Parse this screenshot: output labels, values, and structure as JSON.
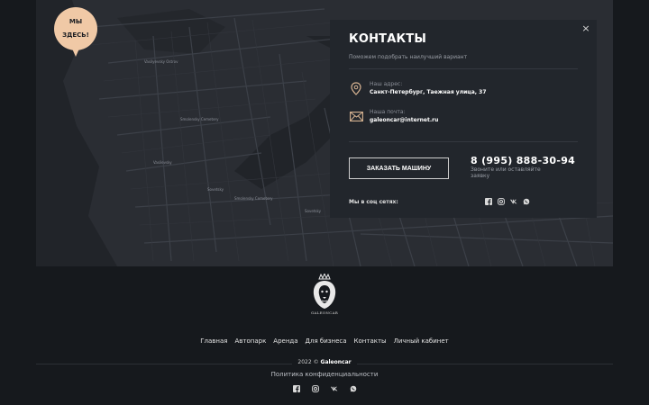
{
  "map": {
    "pin": {
      "line1": "МЫ",
      "line2": "ЗДЕСЬ!"
    },
    "labels": [
      "Smolensky Cemetery",
      "Vasilevsky",
      "Sovetsky",
      "Smolensky Cemetery",
      "Sovetsky",
      "Vasilyevsky Ostrov"
    ]
  },
  "contacts": {
    "close_label": "×",
    "title": "КОНТАКТЫ",
    "subtitle": "Поможем подобрать наилучший вариант",
    "address_label": "Наш адрес:",
    "address_value": "Санкт-Петербург, Таежная улица, 37",
    "email_label": "Наша почта:",
    "email_value": "galeoncar@internet.ru",
    "cta_label": "ЗАКАЗАТЬ МАШИНУ",
    "phone": "8 (995) 888-30-94",
    "phone_note": "Звоните или оставляйте заявку",
    "social_label": "Мы в соц сетях:"
  },
  "footer": {
    "logo_text": "GALEONCAR",
    "nav": [
      "Главная",
      "Автопарк",
      "Аренда",
      "Для бизнеса",
      "Контакты",
      "Личный кабинет"
    ],
    "copyright_year": "2022 ©",
    "copyright_brand": "Galeoncar",
    "policy": "Политика конфиденциальности"
  },
  "icons": {
    "social": [
      "facebook-icon",
      "instagram-icon",
      "vk-icon",
      "whatsapp-icon"
    ]
  },
  "colors": {
    "background": "#16191d",
    "map": "#2a2d33",
    "card": "#22262c",
    "accent_pin": "#f0c9a6"
  }
}
